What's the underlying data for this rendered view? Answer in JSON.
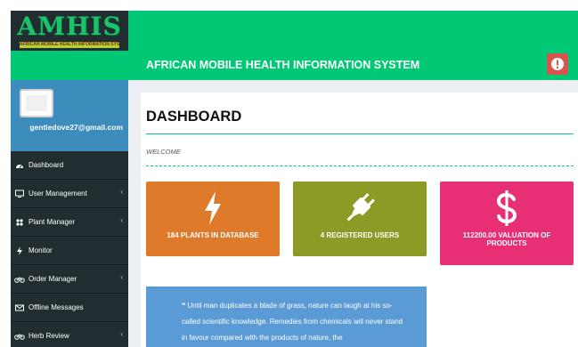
{
  "app": {
    "logo_text": "AMHIS",
    "logo_subtitle": "AFRICAN MOBILE HEALTH INFORMATION SYSTEM",
    "title": "AFRICAN MOBILE HEALTH INFORMATION SYSTEM"
  },
  "user": {
    "email": "gentledove27@gmail.com"
  },
  "sidebar": {
    "items": [
      {
        "label": "Dashboard",
        "icon": "dashboard-icon",
        "has_submenu": false
      },
      {
        "label": "User Management",
        "icon": "desktop-icon",
        "has_submenu": true
      },
      {
        "label": "Plant Manager",
        "icon": "leaf-icon",
        "has_submenu": true
      },
      {
        "label": "Monitor",
        "icon": "bolt-icon",
        "has_submenu": false
      },
      {
        "label": "Order Manager",
        "icon": "bicycle-icon",
        "has_submenu": true
      },
      {
        "label": "Offline Messages",
        "icon": "envelope-icon",
        "has_submenu": false
      },
      {
        "label": "Herb Review",
        "icon": "bicycle-icon",
        "has_submenu": true
      }
    ]
  },
  "main": {
    "title": "DASHBOARD",
    "welcome": "WELCOME",
    "cards": [
      {
        "label": "184 PLANTS IN DATABASE",
        "icon": "bolt-icon",
        "color": "#e07a2b"
      },
      {
        "label": "4 REGISTERED USERS",
        "icon": "plug-icon",
        "color": "#8e9a26"
      },
      {
        "label": "112200.00 VALUATION OF PRODUCTS",
        "icon": "dollar-icon",
        "color": "#e82e74"
      }
    ],
    "quote": "❝ Until man duplicates a blade of grass, nature can laugh at his so-called scientific knowledge. Remedies from chemicals will never stand in favour compared with the products of nature, the"
  },
  "colors": {
    "brand_green": "#00c875",
    "sidebar_dark": "#222d32",
    "user_panel_blue": "#3c8dbc",
    "alert_red": "#d9534f",
    "quote_blue": "#5b9bd5"
  }
}
